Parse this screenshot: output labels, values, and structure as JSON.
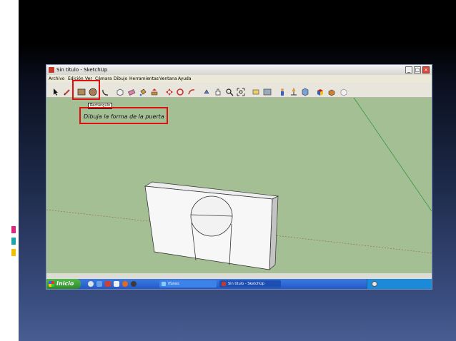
{
  "window": {
    "title": "Sin título - SketchUp",
    "min_symbol": "_",
    "max_symbol": "□",
    "close_symbol": "×"
  },
  "menu": [
    "Archivo",
    "Edición",
    "Ver",
    "Cámara",
    "Dibujo",
    "Herramientas",
    "Ventana",
    "Ayuda"
  ],
  "toolbar": {
    "tools": [
      "select-icon",
      "pencil-icon",
      "rectangle-icon",
      "circle-icon",
      "arc-icon",
      "make-component-icon",
      "eraser-icon",
      "paint-bucket-icon",
      "push-pull-icon",
      "move-icon",
      "rotate-icon",
      "follow-me-icon",
      "scale-icon",
      "offset-icon",
      "tape-measure-icon",
      "protractor-icon",
      "orbit-icon",
      "pan-icon",
      "zoom-icon",
      "zoom-extents-icon",
      "section-plane-icon",
      "dimension-icon",
      "text-icon",
      "axes-icon",
      "3d-text-icon",
      "get-models-icon",
      "share-model-icon",
      "share-component-icon",
      "add-location-icon",
      "extension-warehouse-icon"
    ],
    "tooltip": "Rectángulo"
  },
  "canvas": {
    "instruction": "Dibuja la forma de la puerta"
  },
  "taskbar": {
    "start_label": "Inicio",
    "tasks": [
      "iTunes",
      "Sin título - SketchUp"
    ]
  },
  "colors": {
    "highlight": "#e01010",
    "ground": "#a3bf93",
    "taskbar": "#2459c8",
    "start": "#2f8a2b"
  }
}
